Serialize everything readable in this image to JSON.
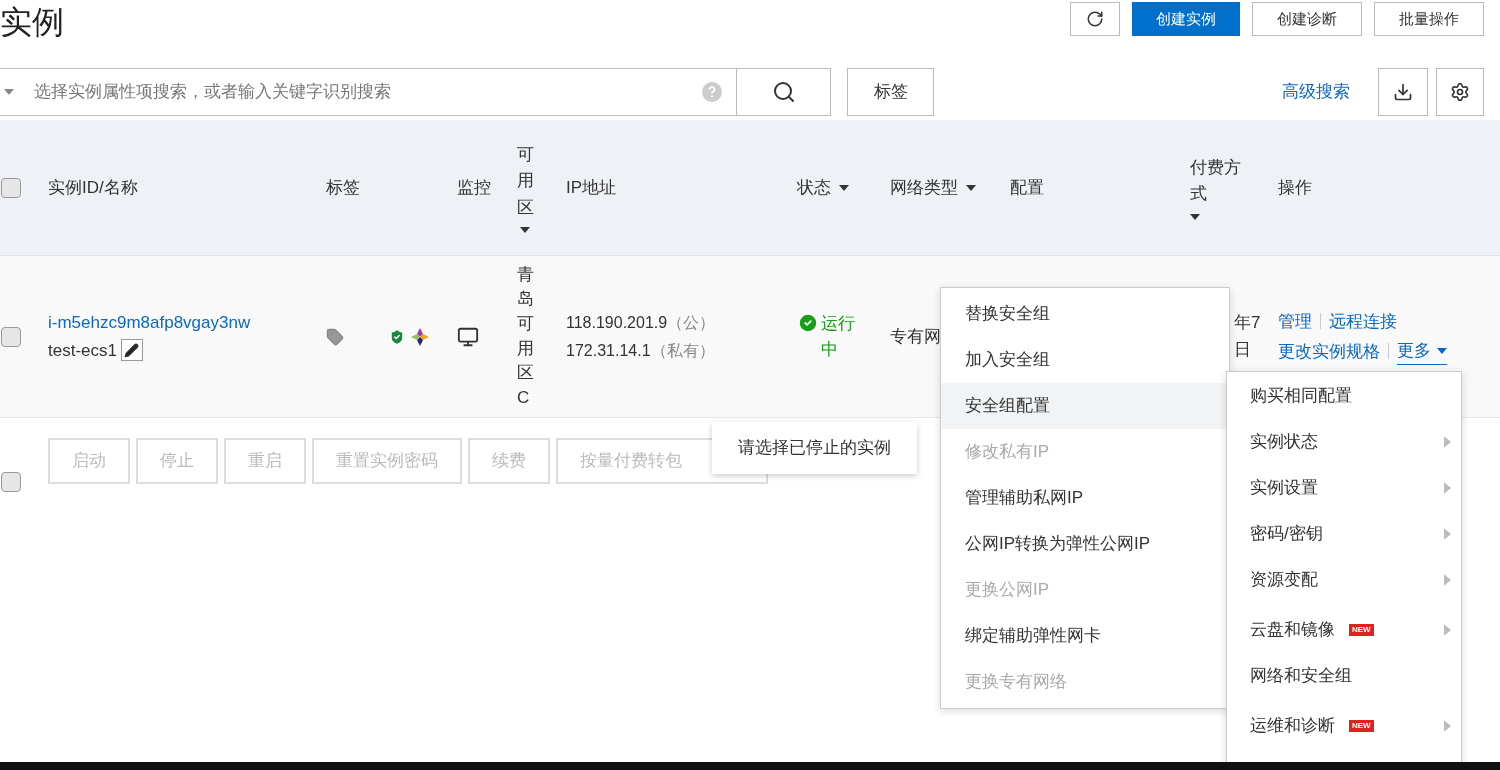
{
  "page": {
    "title": "实例",
    "actions": [
      {
        "label": "创建实例",
        "primary": true
      },
      {
        "label": "创建诊断",
        "primary": false
      },
      {
        "label": "批量操作",
        "primary": false
      }
    ]
  },
  "search": {
    "placeholder": "选择实例属性项搜索，或者输入关键字识别搜索",
    "tag_button": "标签",
    "advanced_link": "高级搜索"
  },
  "table": {
    "columns": [
      {
        "label": "实例ID/名称",
        "filter": false,
        "vertical": false
      },
      {
        "label": "标签",
        "filter": false,
        "vertical": false
      },
      {
        "label": "监控",
        "filter": false,
        "vertical": false
      },
      {
        "label": "可用区",
        "filter": true,
        "vertical": true
      },
      {
        "label": "IP地址",
        "filter": false,
        "vertical": false
      },
      {
        "label": "状态",
        "filter": true,
        "vertical": false
      },
      {
        "label": "网络类型",
        "filter": true,
        "vertical": false
      },
      {
        "label": "配置",
        "filter": false,
        "vertical": false
      },
      {
        "label": "付费方式",
        "filter": true,
        "vertical": false
      },
      {
        "label": "操作",
        "filter": false,
        "vertical": false
      }
    ],
    "all_checked": false,
    "rows": [
      {
        "checked": false,
        "id": "i-m5ehzc9m8afp8vgay3nw",
        "name": "test-ecs1",
        "zone": "青岛可用区C",
        "ip_public": "118.190.201.9",
        "ip_public_tag": "（公）",
        "ip_private": "172.31.14.1",
        "ip_private_tag": "（私有）",
        "status": "运行中",
        "network": "专有网",
        "payment": [
          "年7",
          "日"
        ],
        "operations": [
          "管理",
          "远程连接",
          "更改实例规格"
        ],
        "more": "更多"
      }
    ]
  },
  "bulk": {
    "checked": false,
    "actions": [
      {
        "label": "启动",
        "disabled": true
      },
      {
        "label": "停止",
        "disabled": true
      },
      {
        "label": "重启",
        "disabled": true
      },
      {
        "label": "重置实例密码",
        "disabled": true
      },
      {
        "label": "续费",
        "disabled": true
      },
      {
        "label": "按量付费转包",
        "disabled": true
      }
    ]
  },
  "tooltip": "请选择已停止的实例",
  "security_menu": [
    {
      "label": "替换安全组",
      "disabled": false,
      "selected": false
    },
    {
      "label": "加入安全组",
      "disabled": false,
      "selected": false
    },
    {
      "label": "安全组配置",
      "disabled": false,
      "selected": true
    },
    {
      "label": "修改私有IP",
      "disabled": true,
      "selected": false
    },
    {
      "label": "管理辅助私网IP",
      "disabled": false,
      "selected": false
    },
    {
      "label": "公网IP转换为弹性公网IP",
      "disabled": false,
      "selected": false
    },
    {
      "label": "更换公网IP",
      "disabled": true,
      "selected": false
    },
    {
      "label": "绑定辅助弹性网卡",
      "disabled": false,
      "selected": false
    },
    {
      "label": "更换专有网络",
      "disabled": true,
      "selected": false
    }
  ],
  "more_menu": [
    {
      "label": "购买相同配置",
      "submenu": false
    },
    {
      "label": "实例状态",
      "submenu": true
    },
    {
      "label": "实例设置",
      "submenu": true
    },
    {
      "label": "密码/密钥",
      "submenu": true
    },
    {
      "label": "资源变配",
      "submenu": true
    },
    {
      "label": "云盘和镜像",
      "submenu": true,
      "badge": "NEW"
    },
    {
      "label": "网络和安全组",
      "submenu": false
    },
    {
      "label": "运维和诊断",
      "submenu": true,
      "badge": "NEW"
    }
  ]
}
